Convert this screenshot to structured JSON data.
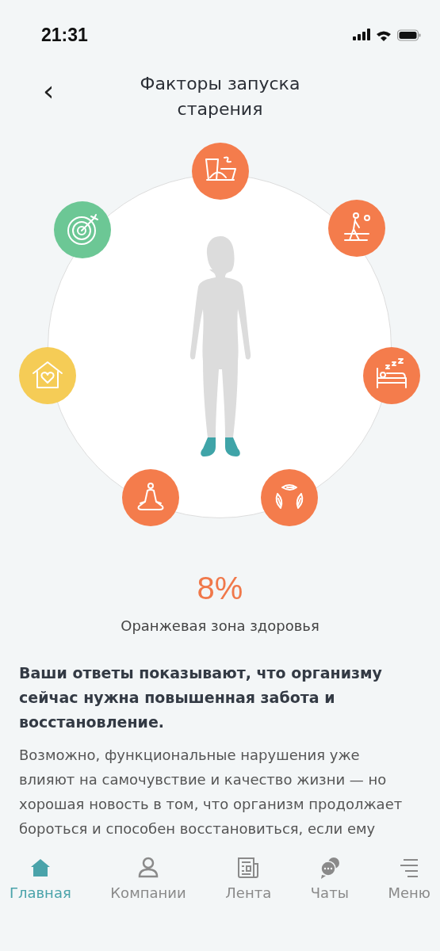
{
  "status_bar": {
    "time": "21:31"
  },
  "header": {
    "back": "‹",
    "title": "Факторы запуска старения"
  },
  "factors": [
    {
      "color": "#f47c4c"
    },
    {
      "color": "#f47c4c"
    },
    {
      "color": "#f47c4c"
    },
    {
      "color": "#f47c4c"
    },
    {
      "color": "#f47c4c"
    },
    {
      "color": "#f5cc56"
    },
    {
      "color": "#6cc795"
    }
  ],
  "result": {
    "percent": "8%",
    "zone": "Оранжевая зона здоровья",
    "heading": "Ваши ответы показывают, что организму сейчас нужна повышенная забота и восстановление.",
    "text": "Возможно, функциональные нарушения уже влияют на самочувствие и качество жизни — но хорошая новость в том, что организм продолжает бороться и способен восстановиться, если ему"
  },
  "tabs": [
    {
      "label": "Главная",
      "selected": true
    },
    {
      "label": "Компании",
      "selected": false
    },
    {
      "label": "Лента",
      "selected": false
    },
    {
      "label": "Чаты",
      "selected": false
    },
    {
      "label": "Меню",
      "selected": false
    }
  ]
}
